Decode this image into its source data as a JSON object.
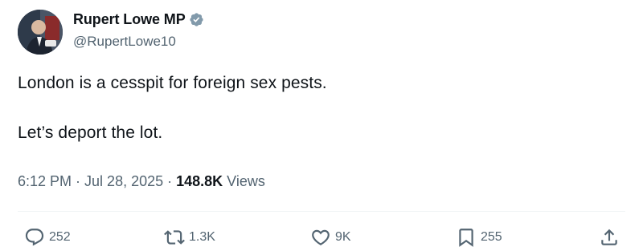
{
  "author": {
    "display_name": "Rupert Lowe MP",
    "handle": "@RupertLowe10",
    "verified_color": "#829aab"
  },
  "tweet": {
    "line1": "London is a cesspit for foreign sex pests.",
    "line2": "Let’s deport the lot."
  },
  "meta": {
    "time": "6:12 PM",
    "separator": " · ",
    "date": "Jul 28, 2025",
    "separator2": " · ",
    "views_count": "148.8K",
    "views_label": " Views"
  },
  "actions": {
    "reply_count": "252",
    "retweet_count": "1.3K",
    "like_count": "9K",
    "bookmark_count": "255"
  },
  "icons": {
    "reply": "reply-icon",
    "retweet": "retweet-icon",
    "like": "heart-icon",
    "bookmark": "bookmark-icon",
    "share": "share-icon",
    "verified": "verified-badge-icon"
  },
  "colors": {
    "text_primary": "#0f1419",
    "text_secondary": "#536471",
    "divider": "#eff3f4"
  }
}
